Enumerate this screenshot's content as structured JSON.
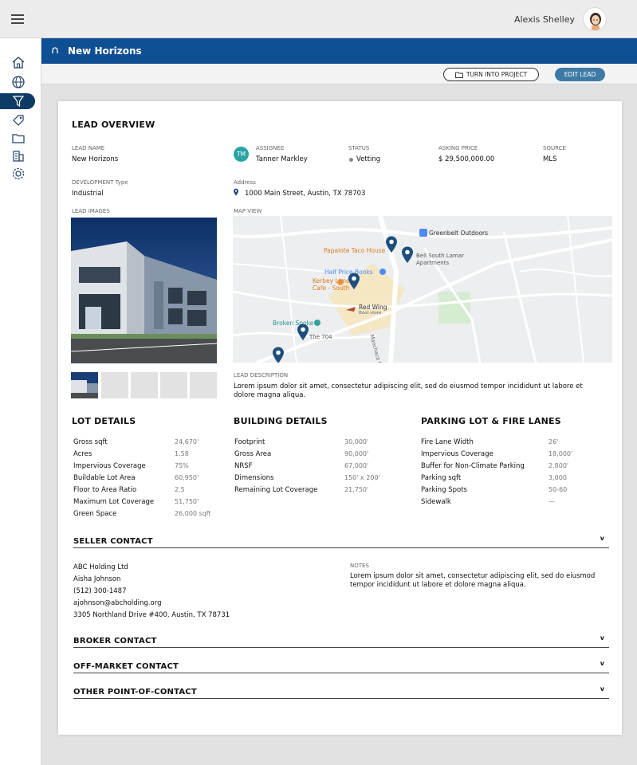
{
  "topbar": {
    "user_name": "Alexis Shelley"
  },
  "header": {
    "title": "New Horizons"
  },
  "actions": {
    "turn_into_project": "TURN INTO PROJECT",
    "edit_lead": "EDIT LEAD"
  },
  "overview": {
    "title": "LEAD OVERVIEW",
    "lead_name_label": "LEAD NAME",
    "lead_name": "New Horizons",
    "assignee_label": "ASSIGNEE",
    "assignee_initials": "TM",
    "assignee": "Tanner Markley",
    "status_label": "STATUS",
    "status": "Vetting",
    "asking_price_label": "ASKING PRICE",
    "asking_price": "$ 29,500,000.00",
    "source_label": "SOURCE",
    "source": "MLS",
    "dev_type_label": "DEVELOPMENT Type",
    "dev_type": "Industrial",
    "address_label": "Address",
    "address": "1000 Main Street, Austin, TX 78703",
    "images_label": "LEAD IMAGES",
    "map_label": "MAP VIEW",
    "description_label": "LEAD DESCRIPTION",
    "description": "Lorem ipsum dolor sit amet, consectetur adipiscing elit, sed do eiusmod tempor incididunt ut labore et dolore magna aliqua."
  },
  "map": {
    "labels": {
      "greenbelt": "Greenbelt Outdoors",
      "papalote": "Papalote Taco House",
      "bell": "Bell South Lamar Apartments",
      "half_price": "Half Price Books",
      "kerbey": "Kerbey Lane Cafe - South",
      "red_wing": "Red Wing",
      "red_wing_sub": "Boot store",
      "broken": "Broken Spoke",
      "the704": "The 704",
      "manchaca": "Manchaca Rd"
    },
    "colors": {
      "road": "#ffffff",
      "land": "#eceeef",
      "green": "#d6ecd2",
      "pin": "#1e4e7c"
    }
  },
  "lot_details": {
    "title": "LOT DETAILS",
    "rows": [
      {
        "label": "Gross sqft",
        "value": "24,670'"
      },
      {
        "label": "Acres",
        "value": "1.58"
      },
      {
        "label": "Impervious Coverage",
        "value": "75%"
      },
      {
        "label": "Buildable Lot Area",
        "value": "60,950'"
      },
      {
        "label": "Floor to Area Ratio",
        "value": "2.5"
      },
      {
        "label": "Maximum Lot Coverage",
        "value": "51,750'"
      },
      {
        "label": "Green Space",
        "value": "26,000 sqft"
      }
    ]
  },
  "building_details": {
    "title": "BUILDING DETAILS",
    "rows": [
      {
        "label": "Footprint",
        "value": "30,000'"
      },
      {
        "label": "Gross Area",
        "value": "90,000'"
      },
      {
        "label": "NRSF",
        "value": "67,000'"
      },
      {
        "label": "Dimensions",
        "value": "150' x 200'"
      },
      {
        "label": "Remaining Lot Coverage",
        "value": "21,750'"
      }
    ]
  },
  "parking": {
    "title": "PARKING LOT & FIRE LANES",
    "rows": [
      {
        "label": "Fire Lane Width",
        "value": "26'"
      },
      {
        "label": "Impervious Coverage",
        "value": "18,000'"
      },
      {
        "label": "Buffer for Non-Climate Parking",
        "value": "2,800'"
      },
      {
        "label": "Parking sqft",
        "value": "3,000"
      },
      {
        "label": "Parking Spots",
        "value": "50-60"
      },
      {
        "label": "Sidewalk",
        "value": "—"
      }
    ]
  },
  "seller": {
    "title": "SELLER CONTACT",
    "company": "ABC Holding Ltd",
    "name": "Aisha Johnson",
    "phone": "(512) 300-1487",
    "email": "ajohnson@abcholding.org",
    "address": "3305 Northland Drive #400, Austin, TX 78731",
    "notes_label": "NOTES",
    "notes": "Lorem ipsum dolor sit amet, consectetur adipiscing elit, sed do eiusmod tempor incididunt ut labore et dolore magna aliqua."
  },
  "contacts": {
    "broker": "BROKER CONTACT",
    "off_market": "OFF-MARKET CONTACT",
    "other": "OTHER POINT-OF-CONTACT",
    "chevron": "v"
  },
  "colors": {
    "brand_blue": "#0f4f93",
    "sidebar_active": "#0d3b66",
    "edit_button": "#3e7aa6",
    "assignee_badge": "#2aa3a3"
  }
}
